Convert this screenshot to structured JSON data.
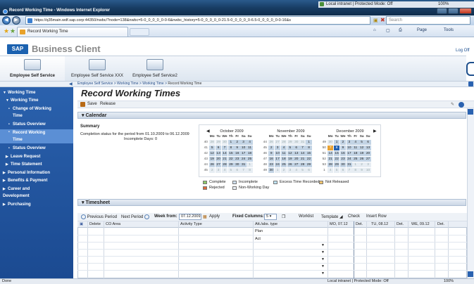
{
  "window": {
    "title": "Record Working Time - Windows Internet Explorer",
    "zone": "Local intranet | Protected Mode: Off",
    "zoom": "100%"
  },
  "address": {
    "url": "https://q35main.wdf.sap.corp:44350/nwbc/?node=138&nwbc=5-0_0_0_0_0-0-6&nwbc_history=5-0_0_0_0_0-21.5-0_0_0_0_0-6.5-0_0_0_0_0-0-16&s",
    "search_placeholder": "Search"
  },
  "tab": {
    "label": "Record Working Time"
  },
  "ie_cmds": {
    "page": "Page",
    "tools": "Tools"
  },
  "bc": {
    "brand": "SAP",
    "name": "Business Client",
    "logoff": "Log Off"
  },
  "menu": [
    {
      "label": "Employee Self Service"
    },
    {
      "label": "Employee Self Service XXX"
    },
    {
      "label": "Employee Self Service2"
    }
  ],
  "breadcrumb": {
    "items": [
      "Employee Self Service",
      "Working Time",
      "Working Time"
    ],
    "current": "Record Working Time",
    "sep": ">"
  },
  "nav": {
    "items": [
      {
        "label": "Working Time",
        "expanded": true
      },
      {
        "label": "Working Time",
        "expanded": true
      },
      {
        "label": "Change of Working"
      },
      {
        "label": "Time"
      },
      {
        "label": "Status Overview"
      },
      {
        "label": "Record Working"
      },
      {
        "label": "Time"
      },
      {
        "label": "Status Overview"
      },
      {
        "label": "Leave Request"
      },
      {
        "label": "Time Statement"
      },
      {
        "label": "Personal Information"
      },
      {
        "label": "Benefits & Payment"
      },
      {
        "label": "Career and"
      },
      {
        "label": "Development"
      },
      {
        "label": "Purchasing"
      }
    ]
  },
  "page": {
    "title": "Record Working Times",
    "save": "Save",
    "release": "Release"
  },
  "calendar": {
    "header": "Calendar",
    "summary": "Summary",
    "completion": "Completion status for the period from 01.10.2009 to 06.12.2009",
    "incomplete_label": "Incomplete Days:",
    "incomplete_value": "0",
    "weekdays": [
      "Mo",
      "Tu",
      "We",
      "Th",
      "Fr",
      "Sa",
      "Su"
    ],
    "months": [
      {
        "name": "October 2009",
        "weeks": [
          [
            "40",
            "28",
            "29",
            "30",
            "1",
            "2",
            "3",
            "4"
          ],
          [
            "41",
            "5",
            "6",
            "7",
            "8",
            "9",
            "10",
            "11"
          ],
          [
            "42",
            "12",
            "13",
            "14",
            "15",
            "16",
            "17",
            "18"
          ],
          [
            "43",
            "19",
            "20",
            "21",
            "22",
            "23",
            "24",
            "25"
          ],
          [
            "44",
            "26",
            "27",
            "28",
            "29",
            "30",
            "31",
            "1"
          ],
          [
            "45",
            "2",
            "3",
            "4",
            "5",
            "6",
            "7",
            "8"
          ]
        ]
      },
      {
        "name": "November 2009",
        "weeks": [
          [
            "44",
            "26",
            "27",
            "28",
            "29",
            "30",
            "31",
            "1"
          ],
          [
            "45",
            "2",
            "3",
            "4",
            "5",
            "6",
            "7",
            "8"
          ],
          [
            "46",
            "9",
            "10",
            "11",
            "12",
            "13",
            "14",
            "15"
          ],
          [
            "47",
            "16",
            "17",
            "18",
            "19",
            "20",
            "21",
            "22"
          ],
          [
            "48",
            "23",
            "24",
            "25",
            "26",
            "27",
            "28",
            "29"
          ],
          [
            "49",
            "30",
            "1",
            "2",
            "3",
            "4",
            "5",
            "6"
          ]
        ]
      },
      {
        "name": "December 2009",
        "weeks": [
          [
            "49",
            "30",
            "1",
            "2",
            "3",
            "4",
            "5",
            "6"
          ],
          [
            "50",
            "7",
            "8",
            "9",
            "10",
            "11",
            "12",
            "13"
          ],
          [
            "51",
            "14",
            "15",
            "16",
            "17",
            "18",
            "19",
            "20"
          ],
          [
            "52",
            "21",
            "22",
            "23",
            "24",
            "25",
            "26",
            "27"
          ],
          [
            "53",
            "28",
            "29",
            "30",
            "31",
            "1",
            "2",
            "3"
          ],
          [
            "1",
            "4",
            "5",
            "6",
            "7",
            "8",
            "9",
            "10"
          ]
        ]
      }
    ],
    "legend": [
      {
        "label": "Complete",
        "color": "#8cc86a"
      },
      {
        "label": "Incomplete",
        "color": "#cfe0ee"
      },
      {
        "label": "Excess Time Recorded",
        "color": "#bfe3f2"
      },
      {
        "label": "Not Released",
        "color": "#f2c46d"
      },
      {
        "label": "Rejected",
        "color": "#e06a3a"
      },
      {
        "label": "Non-Working Day",
        "color": "#e8edf2"
      }
    ]
  },
  "timesheet": {
    "header": "Timesheet",
    "prev": "Previous Period",
    "next": "Next Period",
    "week_from_label": "Week from:",
    "week_from_value": "07.12.2009",
    "apply": "Apply",
    "fixed_cols_label": "Fixed Columns:",
    "fixed_cols_value": "5",
    "worklist": "Worklist",
    "template": "Template",
    "check": "Check",
    "insert_row": "Insert Row",
    "columns": [
      "Delete",
      "CO Area",
      "Activity Type",
      "Att./abs. type",
      "MO, 07.12",
      "Det.",
      "TU, 08.12",
      "Det.",
      "WE, 09.12",
      "Det."
    ],
    "rows": [
      {
        "label": "Plan"
      },
      {
        "label": "Act"
      }
    ]
  },
  "status": {
    "left": "Done",
    "zone": "Local intranet | Protected Mode: Off",
    "zoom": "100%"
  }
}
